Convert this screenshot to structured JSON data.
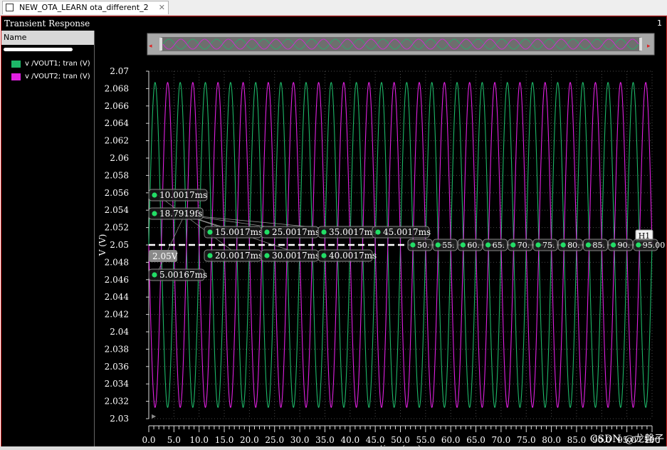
{
  "tab": {
    "title": "NEW_OTA_LEARN ota_different_2 sch..."
  },
  "window": {
    "title": "Transient Response",
    "number": "1"
  },
  "legend": {
    "header": "Name",
    "items": [
      {
        "label": "v /VOUT1; tran (V)",
        "color": "#1db868"
      },
      {
        "label": "v /VOUT2; tran (V)",
        "color": "#e020e0"
      }
    ]
  },
  "colors": {
    "background": "#000000",
    "grid": "#4a4a4a",
    "axis_text": "#ffffff",
    "marker": "#ffffff",
    "label_dot": "#22dd66"
  },
  "watermark": "CSDN @龙磐子",
  "marker": {
    "name": "H1",
    "value_label": "2.05V",
    "labels": [
      "10.0017ms",
      "18.7919fs",
      "5.00167ms",
      "15.0017ms",
      "25.0017ms",
      "35.0017ms",
      "45.0017ms",
      "20.0017ms",
      "30.0017ms",
      "40.0017ms"
    ],
    "right_labels": [
      "50.",
      "55.",
      "60.",
      "65.",
      "70.",
      "75.",
      "80.",
      "85.",
      "90.",
      "95.00"
    ]
  },
  "chart_data": {
    "type": "line",
    "title": "Transient Response",
    "xlabel": "time (ms)",
    "ylabel": "V (V)",
    "xlim": [
      0,
      100
    ],
    "ylim": [
      2.03,
      2.07
    ],
    "x_ticks": [
      "0.0",
      "5.0",
      "10.0",
      "15.0",
      "20.0",
      "25.0",
      "30.0",
      "35.0",
      "40.0",
      "45.0",
      "50.0",
      "55.0",
      "60.0",
      "65.0",
      "70.0",
      "75.0",
      "80.0",
      "85.0",
      "90.0",
      "95.0",
      "100"
    ],
    "y_ticks": [
      "2.07",
      "2.068",
      "2.066",
      "2.064",
      "2.062",
      "2.06",
      "2.058",
      "2.056",
      "2.054",
      "2.052",
      "2.05",
      "2.048",
      "2.046",
      "2.044",
      "2.042",
      "2.04",
      "2.038",
      "2.036",
      "2.034",
      "2.032",
      "2.03"
    ],
    "grid": true,
    "legend_position": "left panel",
    "series": [
      {
        "name": "v /VOUT1; tran (V)",
        "waveform": "sine",
        "offset": 2.05,
        "amplitude": 0.0187,
        "period_ms": 5.0,
        "crosses_up_ms": 0,
        "color": "#1db868"
      },
      {
        "name": "v /VOUT2; tran (V)",
        "waveform": "sine",
        "offset": 2.05,
        "amplitude": 0.0187,
        "period_ms": 5.0,
        "crosses_up_ms": 2.5,
        "color": "#e020e0"
      }
    ],
    "horizontal_marker": {
      "name": "H1",
      "y": 2.05
    }
  }
}
